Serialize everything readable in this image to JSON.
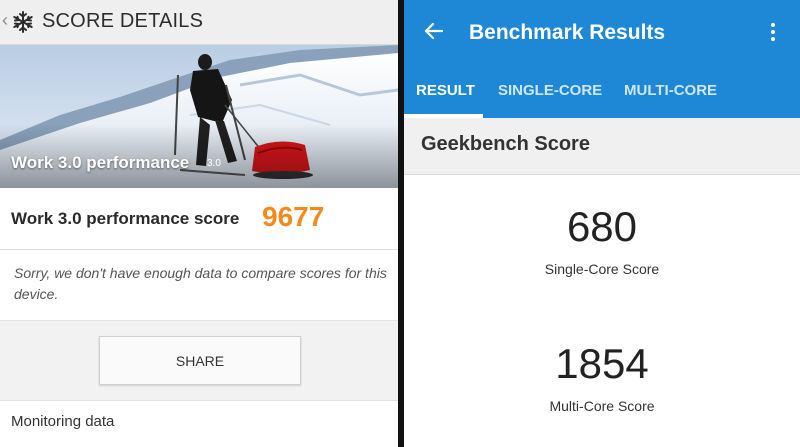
{
  "left": {
    "header_title": "SCORE DETAILS",
    "hero_title": "Work 3.0 performance",
    "hero_version": "3.0",
    "score_label": "Work 3.0 performance score",
    "score_value": "9677",
    "notice": "Sorry, we don't have enough data to compare scores for this device.",
    "share_label": "SHARE",
    "monitoring_label": "Monitoring data",
    "score_color": "#f28a1e"
  },
  "right": {
    "title": "Benchmark Results",
    "tabs": [
      {
        "label": "RESULT",
        "active": true
      },
      {
        "label": "SINGLE-CORE",
        "active": false
      },
      {
        "label": "MULTI-CORE",
        "active": false
      }
    ],
    "section_title": "Geekbench Score",
    "single_core_value": "680",
    "single_core_label": "Single-Core Score",
    "multi_core_value": "1854",
    "multi_core_label": "Multi-Core Score",
    "accent_color": "#1e88d6"
  }
}
